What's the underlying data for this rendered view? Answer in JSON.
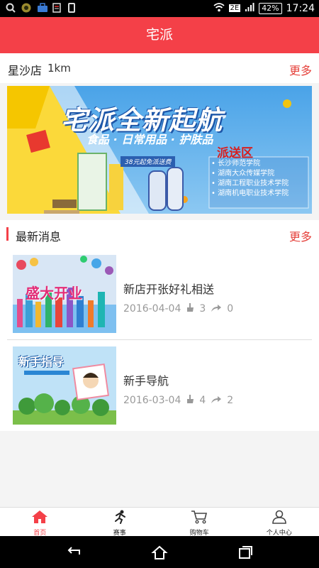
{
  "status_bar": {
    "battery": "42%",
    "network": "2E",
    "time": "17:24",
    "left_icons": [
      "search-icon",
      "browser-icon",
      "briefcase-icon",
      "sim-icon",
      "phone-icon"
    ]
  },
  "header": {
    "title": "宅派"
  },
  "store": {
    "name": "星沙店",
    "distance": "1km",
    "more_label": "更多"
  },
  "banner": {
    "headline": "宅派全新起航",
    "subline": "食品 · 日常用品 · 护肤品",
    "free_delivery": "38元起免派送费",
    "zone_title": "派送区",
    "zones": [
      "长沙师范学院",
      "湖南大众传媒学院",
      "湖南工程职业技术学院",
      "湖南机电职业技术学院"
    ]
  },
  "news": {
    "title": "最新消息",
    "more_label": "更多",
    "items": [
      {
        "title": "新店开张好礼相送",
        "date": "2016-04-04",
        "likes": "3",
        "shares": "0",
        "thumb_text": "盛大开业"
      },
      {
        "title": "新手导航",
        "date": "2016-03-04",
        "likes": "4",
        "shares": "2",
        "thumb_text": "新手指导"
      }
    ]
  },
  "tabs": [
    {
      "label": "首页",
      "icon": "home-icon",
      "active": true
    },
    {
      "label": "赛事",
      "icon": "runner-icon",
      "active": false
    },
    {
      "label": "购物车",
      "icon": "cart-icon",
      "active": false
    },
    {
      "label": "个人中心",
      "icon": "user-icon",
      "active": false
    }
  ],
  "colors": {
    "accent": "#f44048",
    "more_text": "#e5413b"
  }
}
